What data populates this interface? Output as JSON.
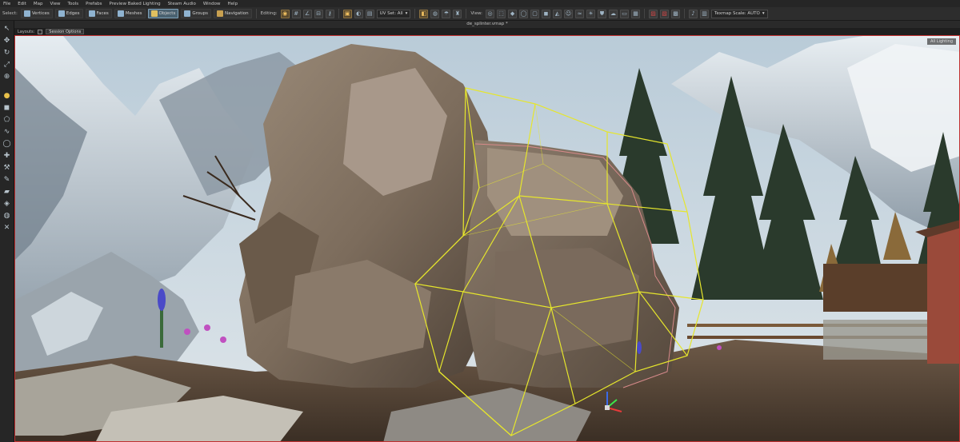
{
  "menu": [
    "File",
    "Edit",
    "Map",
    "View",
    "Tools",
    "Prefabs",
    "Preview Baked Lighting",
    "Steam Audio",
    "Window",
    "Help"
  ],
  "toolbar": {
    "select_label": "Select:",
    "modes": [
      {
        "label": "Vertices",
        "icon": "vertices-icon",
        "color": "#8fb3d0"
      },
      {
        "label": "Edges",
        "icon": "edges-icon",
        "color": "#8fb3d0"
      },
      {
        "label": "Faces",
        "icon": "faces-icon",
        "color": "#8fb3d0"
      },
      {
        "label": "Meshes",
        "icon": "meshes-icon",
        "color": "#8fb3d0"
      },
      {
        "label": "Objects",
        "icon": "objects-icon",
        "color": "#e0c060",
        "active": true
      },
      {
        "label": "Groups",
        "icon": "groups-icon",
        "color": "#8fb3d0"
      },
      {
        "label": "Navigation",
        "icon": "navigation-icon",
        "color": "#c8a050"
      }
    ],
    "editing_label": "Editing:",
    "uv_set": "UV Set: All",
    "view_label": "View:",
    "texmap_scale": "Texmap Scale: AUTO"
  },
  "document": {
    "title": "de_splinter.vmap *"
  },
  "viewport_header": {
    "layouts_label": "Layouts:",
    "dropdown": "Session Options"
  },
  "viewport": {
    "badge": "All Lighting"
  },
  "colors": {
    "selection_wire": "#e6e62c",
    "viewport_border": "#c23030",
    "accent": "#e0c060"
  }
}
